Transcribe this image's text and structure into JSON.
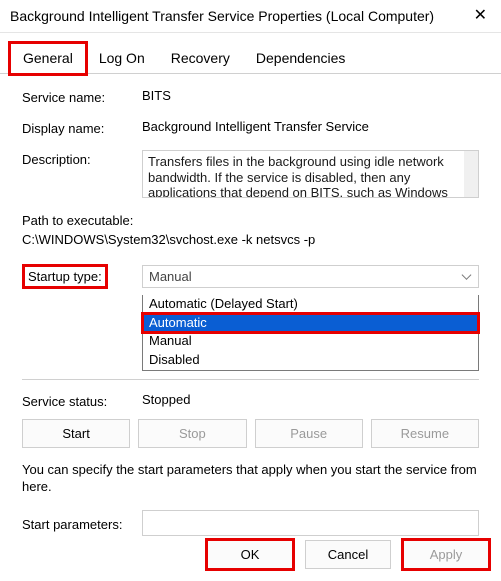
{
  "window": {
    "title": "Background Intelligent Transfer Service Properties (Local Computer)"
  },
  "tabs": {
    "general": "General",
    "logon": "Log On",
    "recovery": "Recovery",
    "dependencies": "Dependencies"
  },
  "labels": {
    "service_name": "Service name:",
    "display_name": "Display name:",
    "description": "Description:",
    "path": "Path to executable:",
    "startup_type": "Startup type:",
    "service_status": "Service status:",
    "start_parameters": "Start parameters:"
  },
  "values": {
    "service_name": "BITS",
    "display_name": "Background Intelligent Transfer Service",
    "description": "Transfers files in the background using idle network bandwidth. If the service is disabled, then any applications that depend on BITS, such as Windows",
    "path": "C:\\WINDOWS\\System32\\svchost.exe -k netsvcs -p",
    "startup_selected": "Manual",
    "service_status": "Stopped",
    "start_parameters": ""
  },
  "dropdown": {
    "options": [
      "Automatic (Delayed Start)",
      "Automatic",
      "Manual",
      "Disabled"
    ],
    "highlighted_index": 1
  },
  "buttons": {
    "start": "Start",
    "stop": "Stop",
    "pause": "Pause",
    "resume": "Resume",
    "ok": "OK",
    "cancel": "Cancel",
    "apply": "Apply"
  },
  "note": "You can specify the start parameters that apply when you start the service from here.",
  "highlights": {
    "red_boxed": [
      "tab-general",
      "startup-type-label",
      "dropdown-automatic",
      "ok-button",
      "apply-button"
    ]
  }
}
